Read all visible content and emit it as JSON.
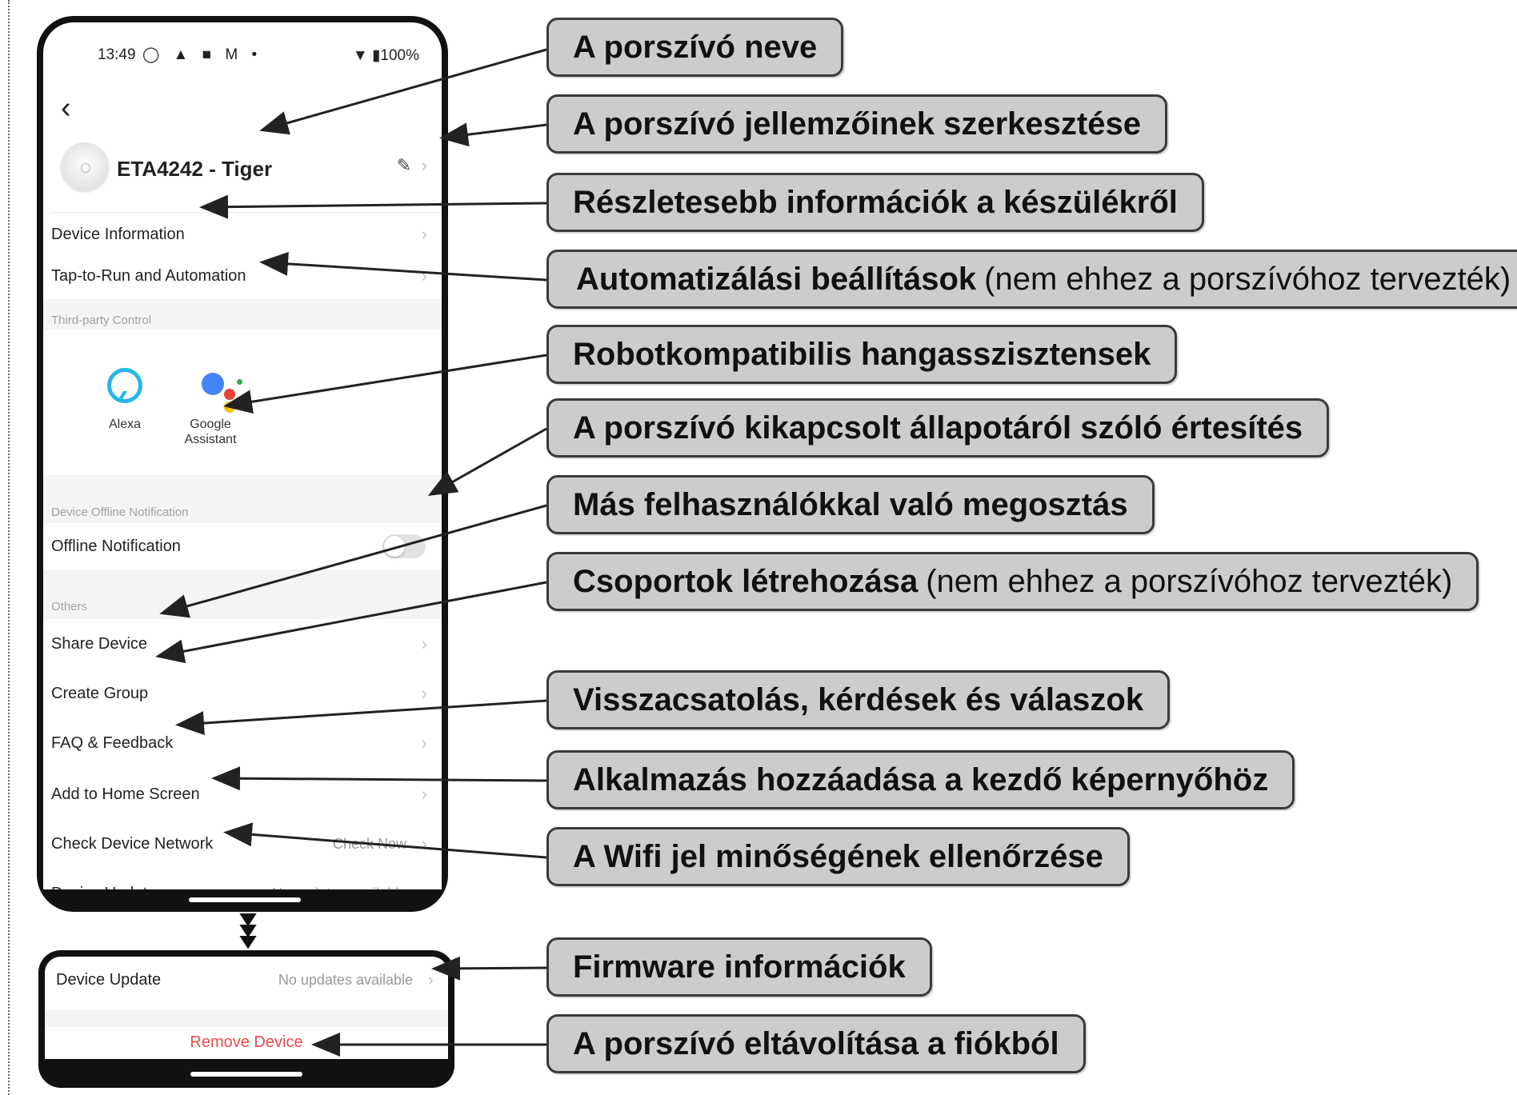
{
  "status_bar": {
    "time": "13:49",
    "icons": "◯ ▲ ■ M •",
    "battery": "▼ ▮100%"
  },
  "device": {
    "name": "ETA4242 - Tiger",
    "edit_icon": "✎",
    "chevron": "›"
  },
  "menu": {
    "device_information": "Device Information",
    "tap_to_run": "Tap-to-Run and Automation",
    "third_party_title": "Third-party Control",
    "alexa": "Alexa",
    "google_line1": "Google",
    "google_line2": "Assistant",
    "offline_title": "Device Offline Notification",
    "offline_notification": "Offline Notification",
    "offline_toggle_on": false,
    "others_title": "Others",
    "share_device": "Share Device",
    "create_group": "Create Group",
    "faq": "FAQ & Feedback",
    "add_home": "Add to Home Screen",
    "check_network": "Check Device Network",
    "check_now": "Check Now",
    "device_update": "Device Update",
    "no_updates": "No updates available",
    "remove_device": "Remove Device"
  },
  "callouts": {
    "name": "A porszívó neve",
    "edit": "A porszívó jellemzőinek szerkesztése",
    "info": "Részletesebb információk a készülékről",
    "automation_bold": "Automatizálási beállítások",
    "automation_note": "(nem ehhez a porszívóhoz tervezték)",
    "voice": "Robotkompatibilis hangasszisztensek",
    "offline": "A porszívó kikapcsolt állapotáról szóló értesítés",
    "share": "Más felhasználókkal való megosztás",
    "group_bold": "Csoportok létrehozása",
    "group_note": "(nem ehhez a porszívóhoz tervezték)",
    "faq": "Visszacsatolás, kérdések és válaszok",
    "home": "Alkalmazás hozzáadása a kezdő képernyőhöz",
    "wifi": "A Wifi jel minőségének ellenőrzése",
    "firmware": "Firmware információk",
    "remove": "A porszívó eltávolítása a fiókból"
  },
  "colors": {
    "callout_bg": "#cccccc",
    "remove": "#ef4a4a",
    "alexa": "#24b7e6"
  }
}
